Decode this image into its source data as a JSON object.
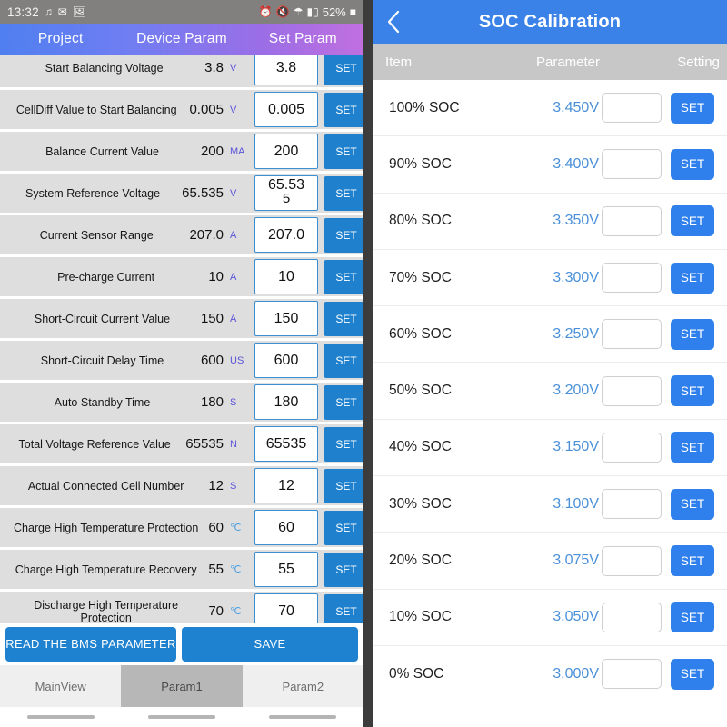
{
  "left": {
    "statusbar": {
      "clock": "13:32",
      "icons": [
        "bluetooth-audio-icon",
        "gmail-icon",
        "photo-icon"
      ],
      "right_icons": [
        "alarm-icon",
        "mute-icon",
        "wifi-icon",
        "signal-icon"
      ],
      "battery": "52%"
    },
    "top_tabs": [
      {
        "label": "Project",
        "name": "tab-project"
      },
      {
        "label": "Device Param",
        "name": "tab-device-param"
      },
      {
        "label": "Set Param",
        "name": "tab-set-param"
      }
    ],
    "rows": [
      {
        "name": "Start Balancing Voltage",
        "value": "3.8",
        "unit": "V",
        "input": "3.8",
        "set": "SET"
      },
      {
        "name": "CellDiff Value to Start Balancing",
        "value": "0.005",
        "unit": "V",
        "input": "0.005",
        "set": "SET"
      },
      {
        "name": "Balance Current Value",
        "value": "200",
        "unit": "MA",
        "input": "200",
        "set": "SET"
      },
      {
        "name": "System Reference Voltage",
        "value": "65.535",
        "unit": "V",
        "input": "65.53",
        "input2": "5",
        "set": "SET"
      },
      {
        "name": "Current Sensor Range",
        "value": "207.0",
        "unit": "A",
        "input": "207.0",
        "set": "SET"
      },
      {
        "name": "Pre-charge Current",
        "value": "10",
        "unit": "A",
        "input": "10",
        "set": "SET"
      },
      {
        "name": "Short-Circuit Current Value",
        "value": "150",
        "unit": "A",
        "input": "150",
        "set": "SET"
      },
      {
        "name": "Short-Circuit Delay Time",
        "value": "600",
        "unit": "US",
        "input": "600",
        "set": "SET"
      },
      {
        "name": "Auto Standby Time",
        "value": "180",
        "unit": "S",
        "input": "180",
        "set": "SET"
      },
      {
        "name": "Total Voltage Reference Value",
        "value": "65535",
        "unit": "N",
        "input": "65535",
        "set": "SET"
      },
      {
        "name": "Actual Connected Cell Number",
        "value": "12",
        "unit": "S",
        "input": "12",
        "set": "SET"
      },
      {
        "name": "Charge High Temperature Protection",
        "value": "60",
        "unit": "℃",
        "input": "60",
        "set": "SET",
        "temp": true
      },
      {
        "name": "Charge High Temperature Recovery",
        "value": "55",
        "unit": "℃",
        "input": "55",
        "set": "SET",
        "temp": true
      },
      {
        "name": "Discharge High Temperature Protection",
        "value": "70",
        "unit": "℃",
        "input": "70",
        "set": "SET",
        "temp": true
      }
    ],
    "actions": {
      "read_label": "READ THE BMS PARAMETER",
      "save_label": "SAVE"
    },
    "bottom_tabs": [
      {
        "label": "MainView",
        "active": false
      },
      {
        "label": "Param1",
        "active": true
      },
      {
        "label": "Param2",
        "active": false
      }
    ]
  },
  "right": {
    "title": "SOC Calibration",
    "back_icon": "chevron-left-icon",
    "columns": {
      "item": "Item",
      "parameter": "Parameter",
      "setting": "Setting"
    },
    "rows": [
      {
        "label": "100% SOC",
        "value": "3.450V",
        "input": "",
        "set": "SET"
      },
      {
        "label": "90% SOC",
        "value": "3.400V",
        "input": "",
        "set": "SET"
      },
      {
        "label": "80% SOC",
        "value": "3.350V",
        "input": "",
        "set": "SET"
      },
      {
        "label": "70% SOC",
        "value": "3.300V",
        "input": "",
        "set": "SET"
      },
      {
        "label": "60% SOC",
        "value": "3.250V",
        "input": "",
        "set": "SET"
      },
      {
        "label": "50% SOC",
        "value": "3.200V",
        "input": "",
        "set": "SET"
      },
      {
        "label": "40% SOC",
        "value": "3.150V",
        "input": "",
        "set": "SET"
      },
      {
        "label": "30% SOC",
        "value": "3.100V",
        "input": "",
        "set": "SET"
      },
      {
        "label": "20% SOC",
        "value": "3.075V",
        "input": "",
        "set": "SET"
      },
      {
        "label": "10% SOC",
        "value": "3.050V",
        "input": "",
        "set": "SET"
      },
      {
        "label": "0% SOC",
        "value": "3.000V",
        "input": "",
        "set": "SET"
      }
    ]
  },
  "colors": {
    "appbar_blue": "#3b82e8",
    "set_blue_left": "#1f81cd",
    "set_blue_right": "#2f80ed",
    "row_gray": "#dededf",
    "unit_purple": "#5a54d8",
    "soc_value_blue": "#4a90d9",
    "gradient_start": "#4f7ff0",
    "gradient_end": "#c06fdf"
  }
}
